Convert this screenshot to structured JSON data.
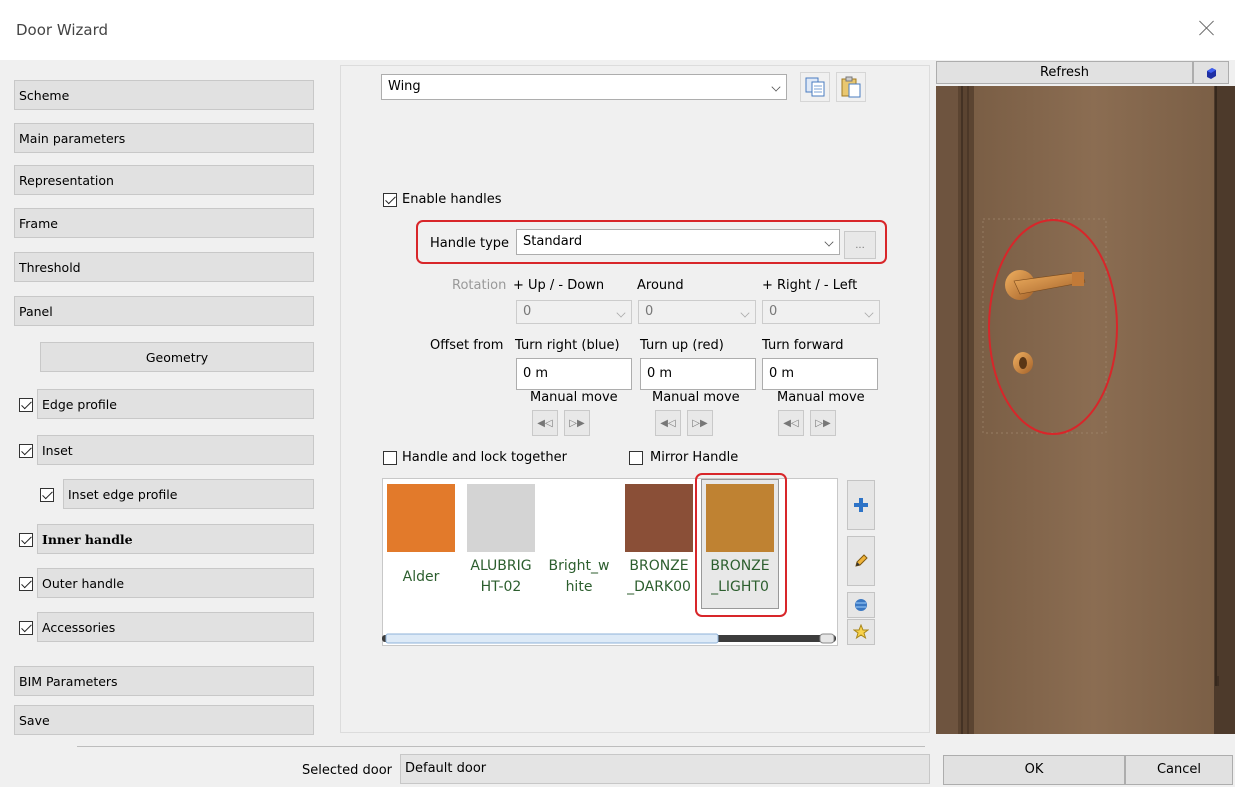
{
  "window": {
    "title": "Door Wizard"
  },
  "nav": {
    "scheme": "Scheme",
    "main_parameters": "Main parameters",
    "representation": "Representation",
    "frame": "Frame",
    "threshold": "Threshold",
    "panel": "Panel",
    "geometry": "Geometry",
    "edge_profile": "Edge profile",
    "inset": "Inset",
    "inset_edge_profile": "Inset edge profile",
    "inner_handle": "Inner handle",
    "outer_handle": "Outer handle",
    "accessories": "Accessories",
    "bim_parameters": "BIM Parameters",
    "save": "Save"
  },
  "part_select": {
    "value": "Wing"
  },
  "enable_handles": {
    "label": "Enable handles",
    "checked": true
  },
  "handle_type": {
    "label": "Handle type",
    "value": "Standard",
    "browse": "..."
  },
  "rotation": {
    "label": "Rotation",
    "col1": "+ Up / - Down",
    "col2": "Around",
    "col3": "+ Right / - Left",
    "v1": "0",
    "v2": "0",
    "v3": "0"
  },
  "offset": {
    "label": "Offset from",
    "col1": "Turn right (blue)",
    "col2": "Turn up (red)",
    "col3": "Turn forward",
    "v1": "0 m",
    "v2": "0 m",
    "v3": "0 m",
    "manual_move": "Manual move"
  },
  "options": {
    "handle_lock_together": "Handle and lock together",
    "mirror_handle": "Mirror Handle"
  },
  "materials": [
    {
      "name": "Alder",
      "color": "#e27a2b"
    },
    {
      "name_l1": "ALUBRIG",
      "name_l2": "HT-02",
      "color": "#d4d4d4"
    },
    {
      "name_l1": "Bright_w",
      "name_l2": "hite",
      "color": "#ffffff"
    },
    {
      "name_l1": "BRONZE",
      "name_l2": "_DARK00",
      "color": "#8a4f37"
    },
    {
      "name_l1": "BRONZE",
      "name_l2": "_LIGHT0",
      "color": "#bf8232"
    }
  ],
  "preview": {
    "refresh": "Refresh"
  },
  "footer": {
    "selected_door_label": "Selected door",
    "selected_door_value": "Default door",
    "ok": "OK",
    "cancel": "Cancel"
  }
}
